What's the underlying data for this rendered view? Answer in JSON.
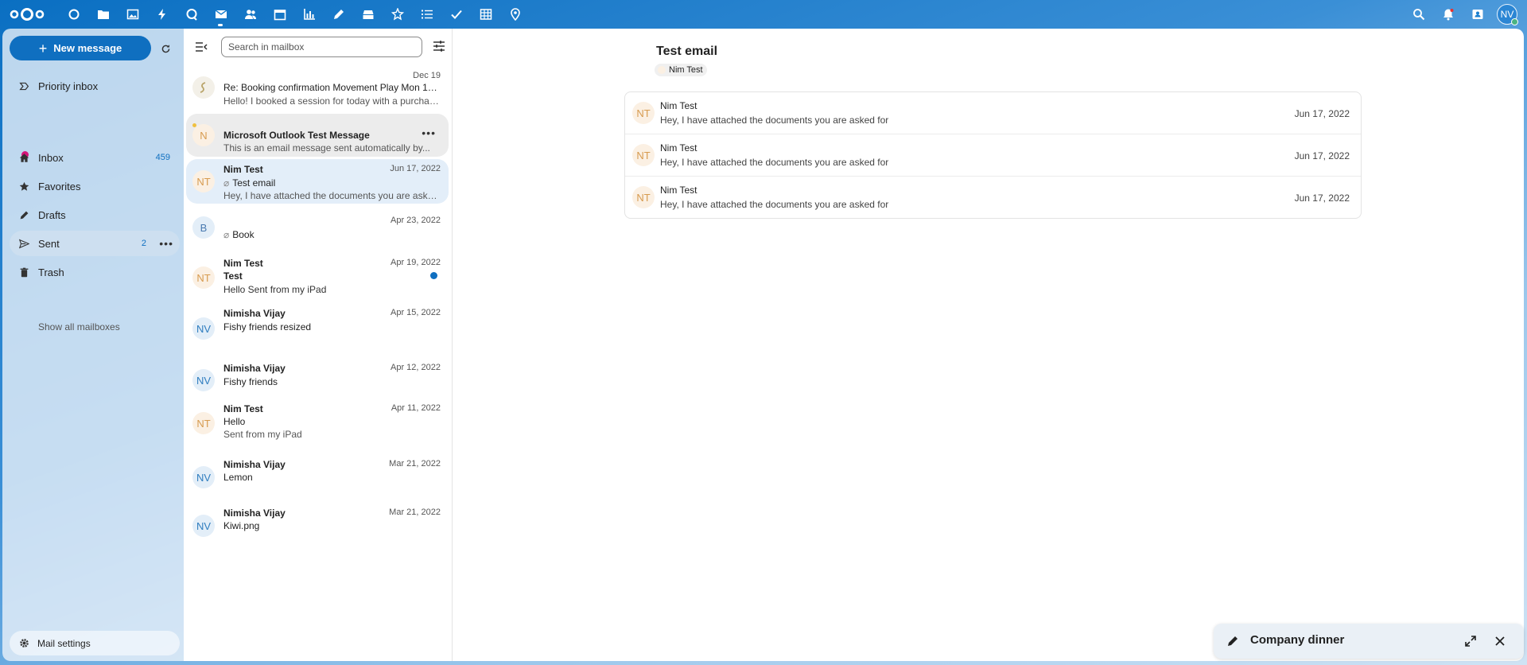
{
  "header": {
    "apps": [
      "dashboard",
      "files",
      "photos",
      "activity",
      "talk",
      "mail",
      "contacts",
      "calendar",
      "analytics",
      "notes",
      "deck",
      "collectives",
      "tasks",
      "checks",
      "tables",
      "maps"
    ],
    "user_initials": "NV"
  },
  "sidebar": {
    "new_message": "New message",
    "priority_inbox": "Priority inbox",
    "inbox": "Inbox",
    "inbox_count": "459",
    "favorites": "Favorites",
    "drafts": "Drafts",
    "sent": "Sent",
    "sent_count": "2",
    "trash": "Trash",
    "show_all": "Show all mailboxes",
    "settings": "Mail settings"
  },
  "list": {
    "search_placeholder": "Search in mailbox",
    "items": [
      {
        "avatar": "",
        "from": "",
        "date": "Dec 19",
        "subject": "Re: Booking confirmation Movement Play Mon 19/1...",
        "preview": "Hello! I booked a session for today with a purchase..."
      },
      {
        "avatar": "N",
        "from": "",
        "date": "",
        "subject": "Microsoft Outlook Test Message",
        "preview": "This is an email message sent automatically by..."
      },
      {
        "avatar": "NT",
        "from": "Nim Test",
        "date": "Jun 17, 2022",
        "subject": "Test email",
        "preview": "Hey, I have attached the documents you are asked for"
      },
      {
        "avatar": "B",
        "from": "",
        "date": "Apr 23, 2022",
        "subject": "Book",
        "preview": ""
      },
      {
        "avatar": "NT",
        "from": "Nim Test",
        "date": "Apr 19, 2022",
        "subject": "Test",
        "preview": "Hello  Sent from my iPad"
      },
      {
        "avatar": "NV",
        "from": "Nimisha Vijay",
        "date": "Apr 15, 2022",
        "subject": "Fishy friends resized",
        "preview": ""
      },
      {
        "avatar": "NV",
        "from": "Nimisha Vijay",
        "date": "Apr 12, 2022",
        "subject": "Fishy friends",
        "preview": ""
      },
      {
        "avatar": "NT",
        "from": "Nim Test",
        "date": "Apr 11, 2022",
        "subject": "Hello",
        "preview": "Sent from my iPad"
      },
      {
        "avatar": "NV",
        "from": "Nimisha Vijay",
        "date": "Mar 21, 2022",
        "subject": "Lemon",
        "preview": ""
      },
      {
        "avatar": "NV",
        "from": "Nimisha Vijay",
        "date": "Mar 21, 2022",
        "subject": "Kiwi.png",
        "preview": ""
      }
    ]
  },
  "reader": {
    "title": "Test email",
    "participant": "Nim Test",
    "thread": [
      {
        "avatar": "NT",
        "from": "Nim Test",
        "preview": "Hey, I have attached the documents you are asked for",
        "date": "Jun 17, 2022"
      },
      {
        "avatar": "NT",
        "from": "Nim Test",
        "preview": "Hey, I have attached the documents you are asked for",
        "date": "Jun 17, 2022"
      },
      {
        "avatar": "NT",
        "from": "Nim Test",
        "preview": "Hey, I have attached the documents you are asked for",
        "date": "Jun 17, 2022"
      }
    ]
  },
  "composer": {
    "title": "Company dinner"
  }
}
